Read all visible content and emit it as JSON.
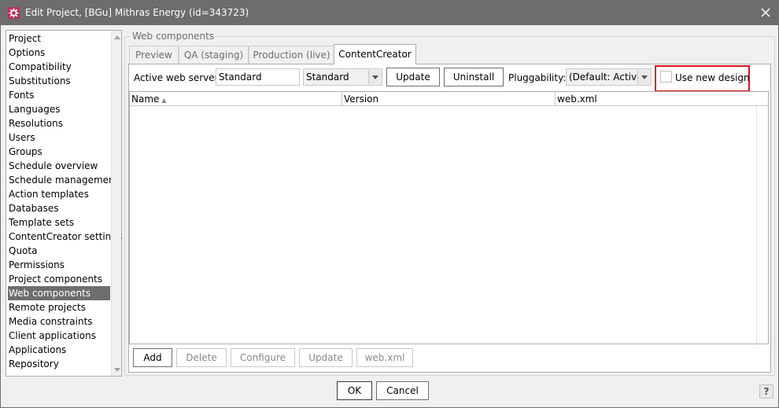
{
  "window": {
    "title": "Edit Project, [BGu] Mithras Energy (id=343723)",
    "app_icon": "gear-icon",
    "close_icon": "close-icon"
  },
  "nav": {
    "items": [
      {
        "label": "Project",
        "selected": false
      },
      {
        "label": "Options",
        "selected": false
      },
      {
        "label": "Compatibility",
        "selected": false
      },
      {
        "label": "Substitutions",
        "selected": false
      },
      {
        "label": "Fonts",
        "selected": false
      },
      {
        "label": "Languages",
        "selected": false
      },
      {
        "label": "Resolutions",
        "selected": false
      },
      {
        "label": "Users",
        "selected": false
      },
      {
        "label": "Groups",
        "selected": false
      },
      {
        "label": "Schedule overview",
        "selected": false
      },
      {
        "label": "Schedule management",
        "selected": false
      },
      {
        "label": "Action templates",
        "selected": false
      },
      {
        "label": "Databases",
        "selected": false
      },
      {
        "label": "Template sets",
        "selected": false
      },
      {
        "label": "ContentCreator settings",
        "selected": false
      },
      {
        "label": "Quota",
        "selected": false
      },
      {
        "label": "Permissions",
        "selected": false
      },
      {
        "label": "Project components",
        "selected": false
      },
      {
        "label": "Web components",
        "selected": true
      },
      {
        "label": "Remote projects",
        "selected": false
      },
      {
        "label": "Media constraints",
        "selected": false
      },
      {
        "label": "Client applications",
        "selected": false
      },
      {
        "label": "Applications",
        "selected": false
      },
      {
        "label": "Repository",
        "selected": false
      }
    ]
  },
  "group": {
    "title": "Web components"
  },
  "tabs": [
    {
      "label": "Preview",
      "active": false
    },
    {
      "label": "QA (staging)",
      "active": false
    },
    {
      "label": "Production (live)",
      "active": false
    },
    {
      "label": "ContentCreator",
      "active": true
    }
  ],
  "toolbar": {
    "server_label": "Active web server:",
    "server_value": "Standard",
    "server_select": "Standard",
    "update_label": "Update",
    "uninstall_label": "Uninstall",
    "pluggability_label": "Pluggability:",
    "pluggability_value": "(Default: Active)",
    "new_design_label": "Use new design",
    "new_design_checked": false
  },
  "table": {
    "columns": [
      {
        "label": "Name",
        "sorted": true
      },
      {
        "label": "Version",
        "sorted": false
      },
      {
        "label": "web.xml",
        "sorted": false
      }
    ],
    "rows": [],
    "sort_icon": "sort-ascending-icon"
  },
  "table_actions": {
    "add": "Add",
    "delete": "Delete",
    "configure": "Configure",
    "update": "Update",
    "webxml": "web.xml"
  },
  "footer": {
    "ok": "OK",
    "cancel": "Cancel",
    "help": "?"
  },
  "colors": {
    "titlebar": "#6d6d6d",
    "selection": "#6d6d6d",
    "highlight": "#e0141e",
    "app_icon": "#b5325b"
  }
}
